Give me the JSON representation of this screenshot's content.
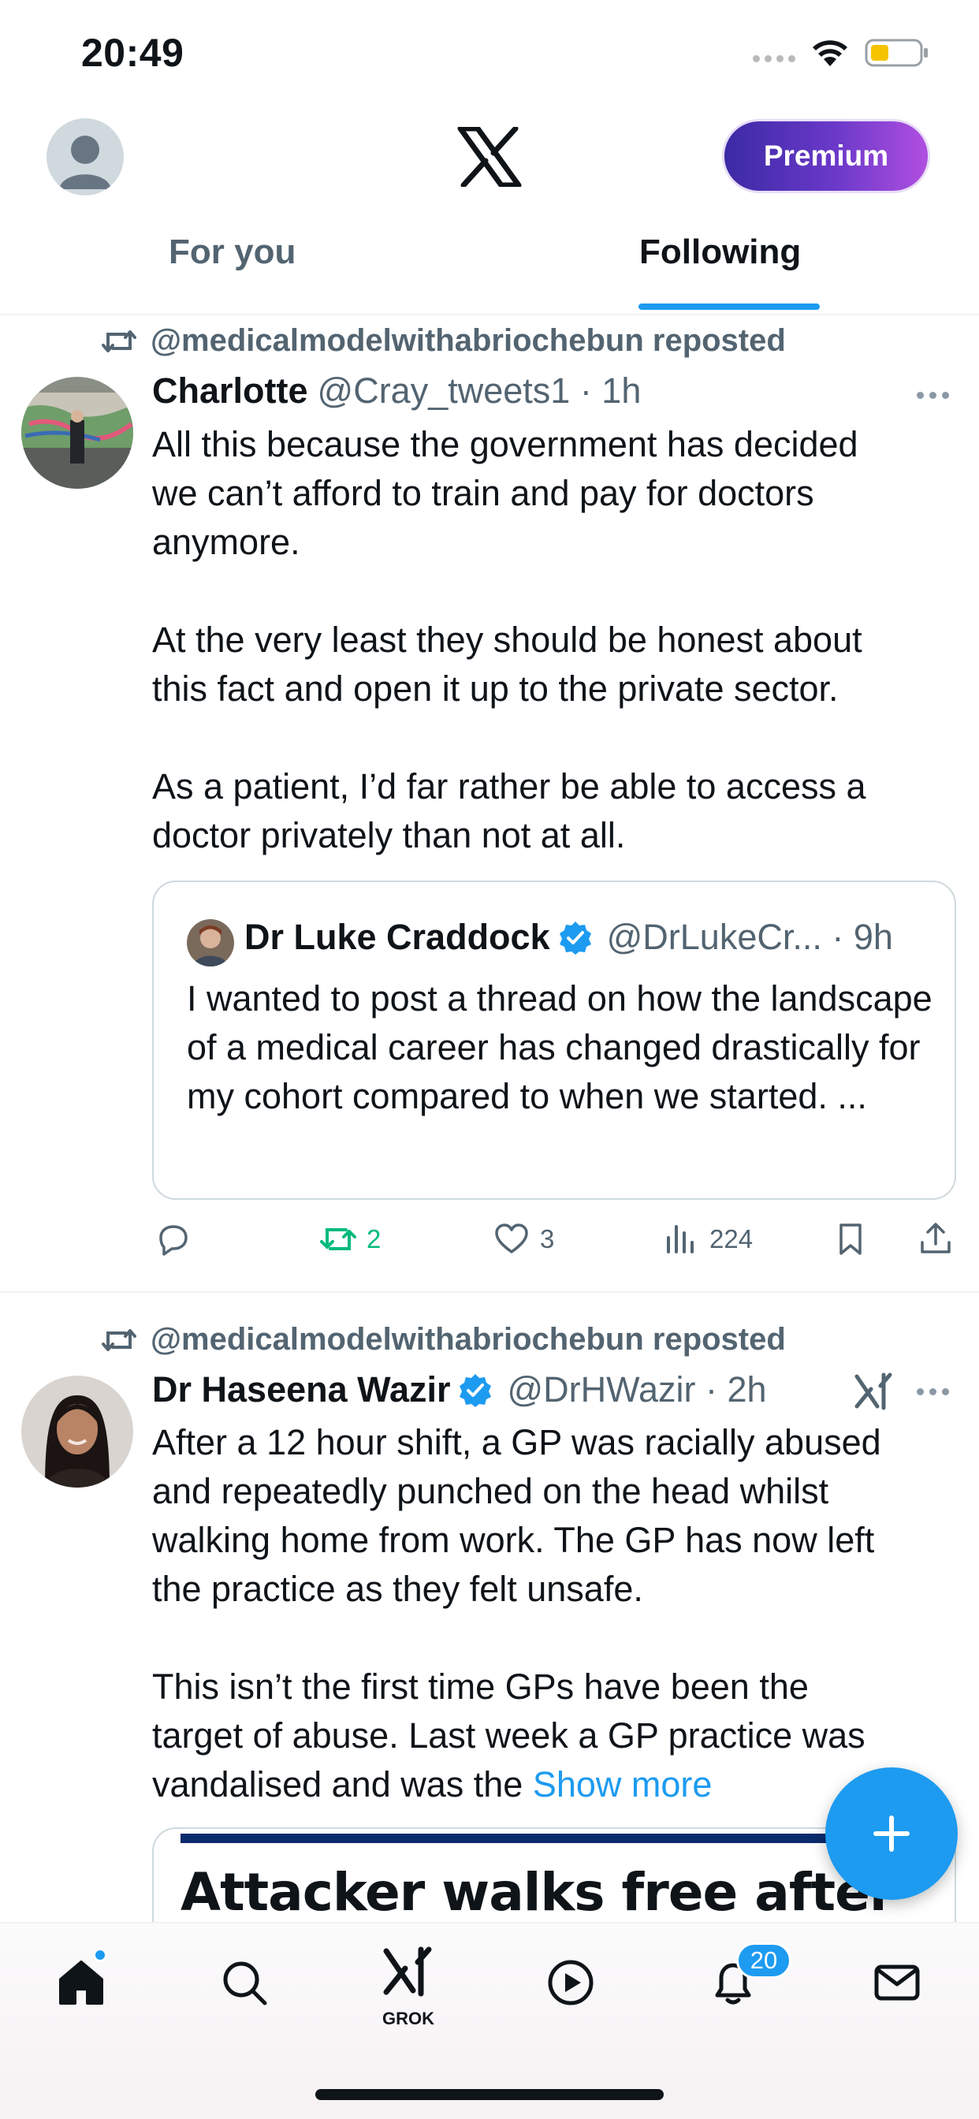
{
  "status_bar": {
    "time": "20:49"
  },
  "header": {
    "premium_label": "Premium",
    "tabs": [
      {
        "label": "For you"
      },
      {
        "label": "Following"
      }
    ]
  },
  "tweets": [
    {
      "repost_text": "@medicalmodelwithabriochebun reposted",
      "name": "Charlotte",
      "handle_time": "@Cray_tweets1 · 1h",
      "text": "All this because the government has decided\nwe can’t afford to train and pay for doctors\nanymore.\n\nAt the very least they should be honest about\nthis fact and open it up to the private sector.\n\nAs a patient, I’d far rather be able to access a\ndoctor privately than not at all.",
      "quote": {
        "name": "Dr Luke Craddock",
        "handle_time": "@DrLukeCr... · 9h",
        "text": "I wanted to post a thread on how the landscape of a medical career has changed drastically for my cohort compared to when we started. ..."
      },
      "stats": {
        "replies": "",
        "retweets": "2",
        "likes": "3",
        "views": "224"
      }
    },
    {
      "repost_text": "@medicalmodelwithabriochebun reposted",
      "name": "Dr Haseena Wazir",
      "handle_time": "@DrHWazir · 2h",
      "text": "After a 12 hour shift, a GP was racially abused\nand repeatedly punched on the head whilst\nwalking home from work. The GP has now left\nthe practice as they felt unsafe.\n\nThis isn’t the first time GPs have been the\ntarget of abuse. Last week a GP practice was\nvandalised and was the ",
      "show_more": "Show more",
      "card_headline": "Attacker walks free after"
    }
  ],
  "bottom_nav": {
    "grok_label": "GROK",
    "notifications_count": "20"
  },
  "colors": {
    "accent": "#1d9bf0",
    "retweet_green": "#00ba7c",
    "text_secondary": "#536471"
  }
}
